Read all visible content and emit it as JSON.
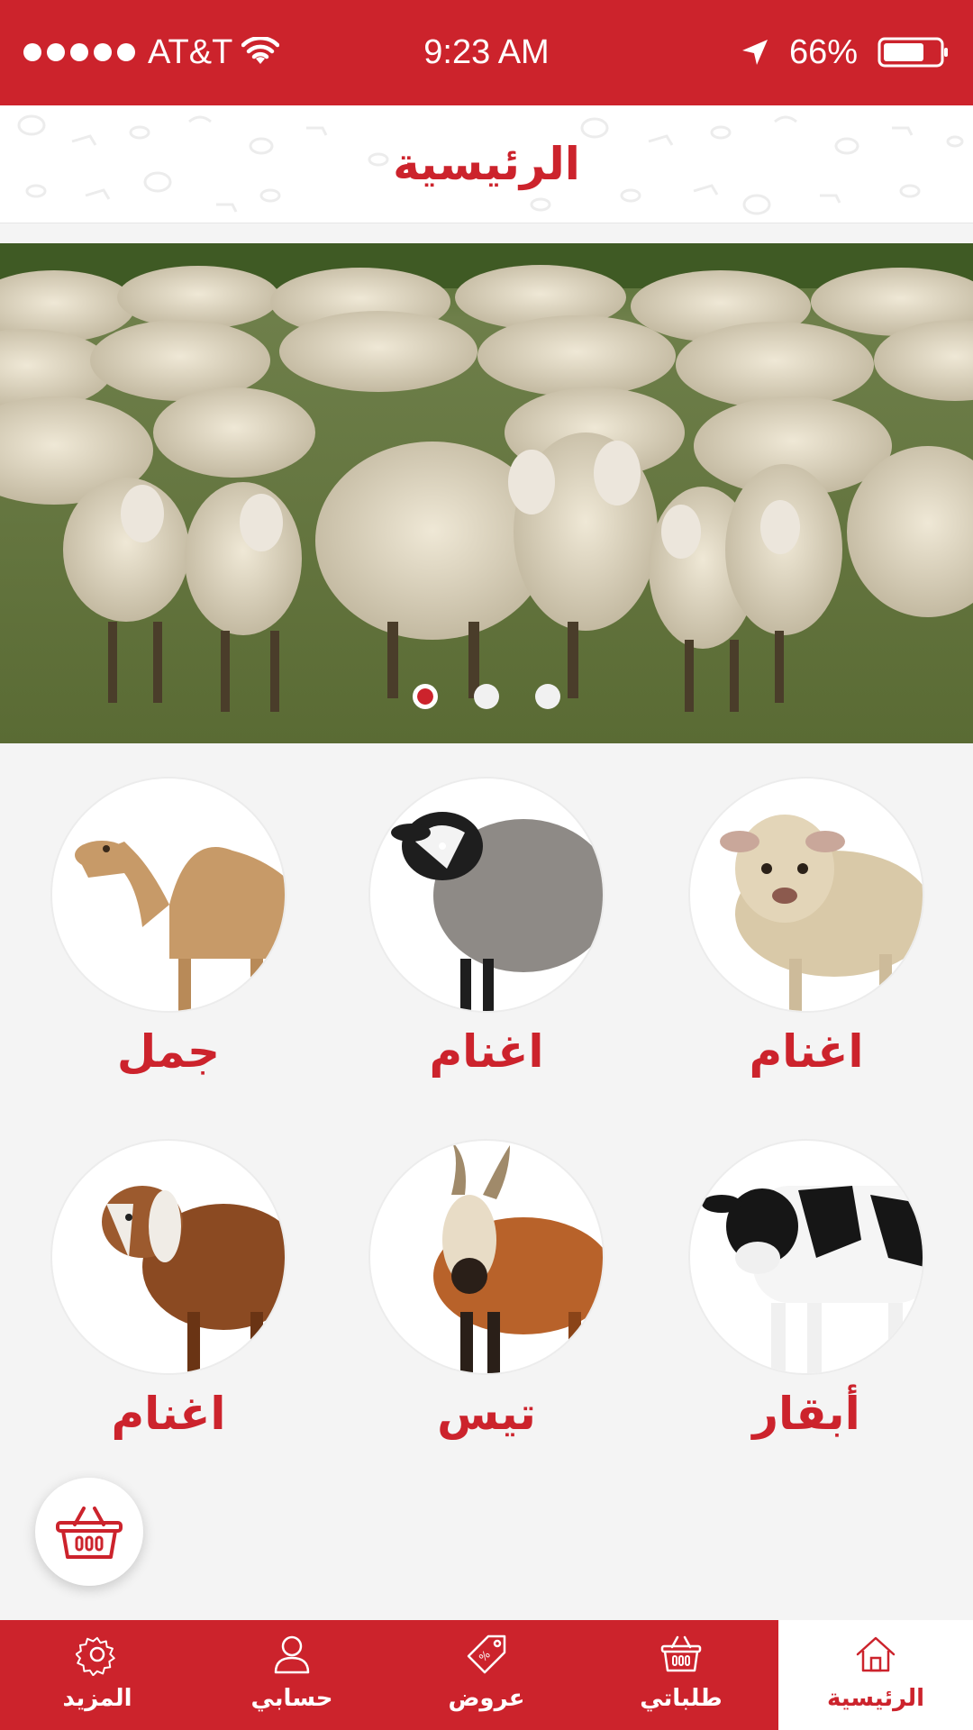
{
  "status_bar": {
    "carrier": "AT&T",
    "time": "9:23 AM",
    "battery": "66%",
    "icons": [
      "signal-dots-icon",
      "wifi-icon",
      "location-arrow-icon",
      "battery-icon"
    ]
  },
  "header": {
    "title": "الرئيسية"
  },
  "banner": {
    "image": "sheep-flock",
    "slide_count": 3,
    "active_slide": 1
  },
  "categories": [
    {
      "label": "اغنام",
      "image": "lamb"
    },
    {
      "label": "اغنام",
      "image": "black-faced-sheep"
    },
    {
      "label": "جمل",
      "image": "camel"
    },
    {
      "label": "أبقار",
      "image": "cow"
    },
    {
      "label": "تيس",
      "image": "billy-goat"
    },
    {
      "label": "اغنام",
      "image": "brown-goat"
    }
  ],
  "floating_button": {
    "icon": "basket-icon"
  },
  "bottom_nav": {
    "items": [
      {
        "label": "المزيد",
        "icon": "gear-icon"
      },
      {
        "label": "حسابي",
        "icon": "user-icon"
      },
      {
        "label": "عروض",
        "icon": "tag-icon"
      },
      {
        "label": "طلباتي",
        "icon": "basket-icon"
      },
      {
        "label": "الرئيسية",
        "icon": "home-icon",
        "active": true
      }
    ]
  },
  "colors": {
    "brand_red": "#cc232c",
    "background": "#f4f4f4",
    "white": "#ffffff"
  }
}
